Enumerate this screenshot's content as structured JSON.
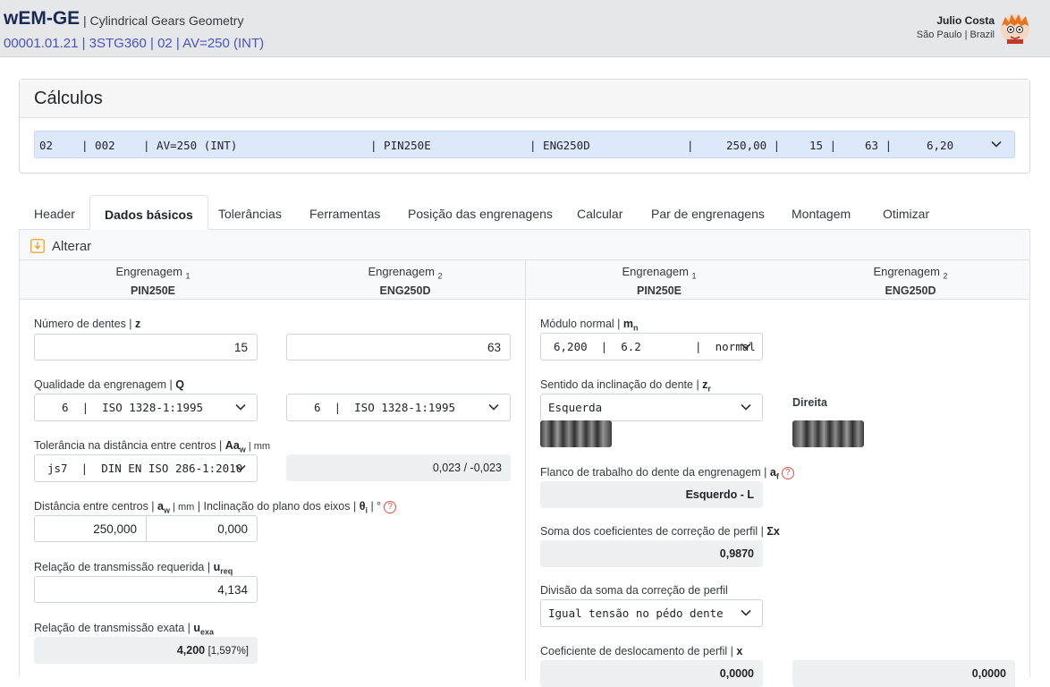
{
  "header": {
    "app_name": "wEM-GE",
    "app_subtitle": "| Cylindrical Gears Geometry",
    "project_line": "00001.01.21 | 3STG360 | 02 | AV=250 (INT)",
    "user_name": "Julio Costa",
    "user_location": "São Paulo | Brazil"
  },
  "calc": {
    "title": "Cálculos",
    "selected": [
      "02",
      "| 002",
      "| AV=250 (INT)",
      "| PIN250E",
      "| ENG250D",
      "|",
      "250,00 |",
      "15 |",
      "63 |",
      "6,20"
    ]
  },
  "tabs": [
    "Header",
    "Dados básicos",
    "Tolerâncias",
    "Ferramentas",
    "Posição das engrenagens",
    "Calcular",
    "Par de engrenagens",
    "Montagem",
    "Otimizar"
  ],
  "active_tab": "Dados básicos",
  "alter_label": "Alterar",
  "gear_headers": {
    "label": "Engrenagem",
    "sub1": "1",
    "sub2": "2",
    "gear1": "PIN250E",
    "gear2": "ENG250D"
  },
  "left": {
    "teeth_label": "Número de dentes | ",
    "teeth_sym": "z",
    "teeth_1": "15",
    "teeth_2": "63",
    "quality_label": "Qualidade da engrenagem | ",
    "quality_sym": "Q",
    "quality_1": "6  |  ISO 1328-1:1995",
    "quality_2": "6  |  ISO 1328-1:1995",
    "tol_label": "Tolerância na distância entre centros | ",
    "tol_sym": "Aa",
    "tol_sub": "w",
    "tol_unit": " | mm",
    "tol_select": "js7  |  DIN EN ISO 286-1:2010",
    "tol_value": "0,023 / -0,023",
    "dist_label": "Distância entre centros | ",
    "dist_sym": "a",
    "dist_sub": "w",
    "dist_unit": " | mm",
    "incl_label": " | Inclinação do plano dos eixos | ",
    "incl_sym": "θ",
    "incl_sub": "i",
    "incl_unit": " | °",
    "dist_value": "250,000",
    "incl_value": "0,000",
    "ureq_label": "Relação de transmissão requerida | ",
    "ureq_sym": "u",
    "ureq_sub": "req",
    "ureq_value": "4,134",
    "uexa_label": "Relação de transmissão exata | ",
    "uexa_sym": "u",
    "uexa_sub": "exa",
    "uexa_value": "4,200",
    "uexa_pct": "[1,597%]"
  },
  "right": {
    "module_label": "Módulo normal | ",
    "module_sym": "m",
    "module_sub": "n",
    "module_select": "6,200  |  6.2        |  normal",
    "helix_label": "Sentido da inclinação do dente | ",
    "helix_sym": "z",
    "helix_sub": "r",
    "helix_select": "Esquerda",
    "helix_2": "Direita",
    "flank_label": "Flanco de trabalho do dente da engrenagem | ",
    "flank_sym": "a",
    "flank_sub": "f",
    "flank_value": "Esquerdo - L",
    "sumx_label": "Soma dos coeficientes de correção de perfil | ",
    "sumx_sym": "Σx",
    "sumx_value": "0,9870",
    "div_label": "Divisão da soma da correção de perfil",
    "div_select": "Igual tensão no pédo dente",
    "coef_label": "Coeficiente de deslocamento de perfil | ",
    "coef_sym": "x",
    "coef_1": "0,0000",
    "coef_2": "0,0000"
  },
  "colors": {
    "accent": "#4a53c3",
    "selected_row": "#dde9fb",
    "help": "#d9534f",
    "alter_icon": "#f0a020"
  }
}
